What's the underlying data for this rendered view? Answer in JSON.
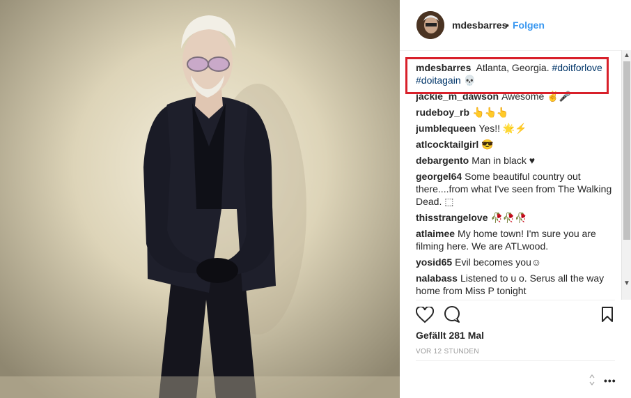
{
  "header": {
    "username": "mdesbarres",
    "dot": "•",
    "follow_label": "Folgen"
  },
  "comments": [
    {
      "user": "mdesbarres",
      "text": "Atlanta, Georgia.",
      "tag1": "#doitforlove",
      "tag2": "#doitagain",
      "emoji": "💀"
    },
    {
      "user": "jackie_m_dawson",
      "text": "Awesome ✌🎤"
    },
    {
      "user": "rudeboy_rb",
      "text": "👆👆👆"
    },
    {
      "user": "jumblequeen",
      "text": "Yes!! 🌟⚡"
    },
    {
      "user": "atlcocktailgirl",
      "text": "😎"
    },
    {
      "user": "debargento",
      "text": "Man in black ♥"
    },
    {
      "user": "georgel64",
      "text": "Some beautiful country out there....from what I've seen from The Walking Dead. ⬚"
    },
    {
      "user": "thisstrangelove",
      "text": "🥀🥀🥀"
    },
    {
      "user": "atlaimee",
      "text": "My home town! I'm sure you are filming here. We are ATLwood."
    },
    {
      "user": "yosid65",
      "text": "Evil becomes you☺"
    },
    {
      "user": "nalabass",
      "text": "Listened to u o. Serus all the way home from Miss P tonight"
    }
  ],
  "likes": "Gefällt 281 Mal",
  "timestamp": "VOR 12 STUNDEN",
  "icons": [
    "heart-icon",
    "comment-icon",
    "bookmark-icon",
    "more-icon"
  ],
  "colors": {
    "link": "#3897f0",
    "hashtag": "#003569",
    "highlight": "#d8202a"
  }
}
